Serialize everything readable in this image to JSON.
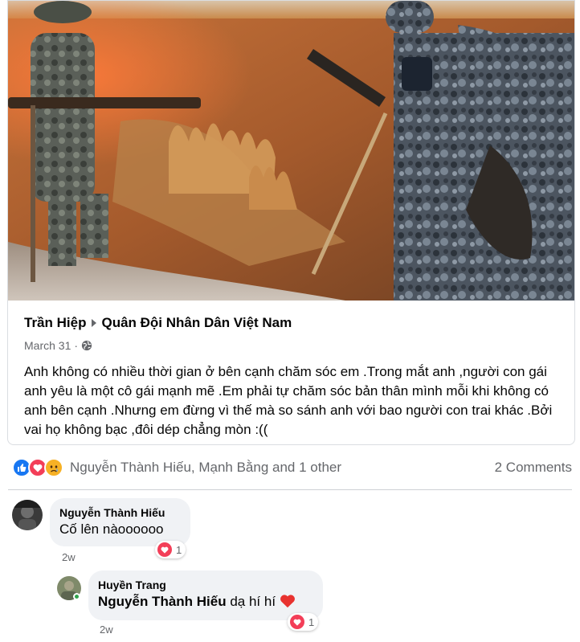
{
  "post": {
    "author": "Trần Hiệp",
    "group": "Quân Đội Nhân Dân Việt Nam",
    "date": "March 31",
    "dot": "·",
    "text": "Anh không có nhiều thời gian ở bên cạnh chăm sóc em .Trong mắt anh ,người con gái anh yêu là một cô gái mạnh mẽ .Em phải tự chăm sóc bản thân mình mỗi khi không có anh bên cạnh .Nhưng em đừng vì thế mà so sánh anh với bao người con trai khác .Bởi vai họ không bạc ,đôi dép chẳng mòn :(("
  },
  "reactions": {
    "icons": [
      "like-icon",
      "love-icon",
      "sad-icon"
    ],
    "names": "Nguyễn Thành Hiếu, Mạnh Bằng and 1 other",
    "comments_count": "2 Comments"
  },
  "comments": [
    {
      "author": "Nguyễn Thành Hiếu",
      "text": "Cố lên nàoooooo",
      "reaction_count": "1",
      "time": "2w"
    }
  ],
  "replies": [
    {
      "author": "Huyền Trang",
      "mention": "Nguyễn Thành Hiếu",
      "text": " dạ hí hí ",
      "reaction_count": "1",
      "time": "2w"
    }
  ],
  "colors": {
    "secondary_text": "#65676b",
    "bubble": "#f0f2f5",
    "like": "#1877f2",
    "love": "#f33e58",
    "sad": "#f7b125",
    "online": "#31a24c"
  }
}
